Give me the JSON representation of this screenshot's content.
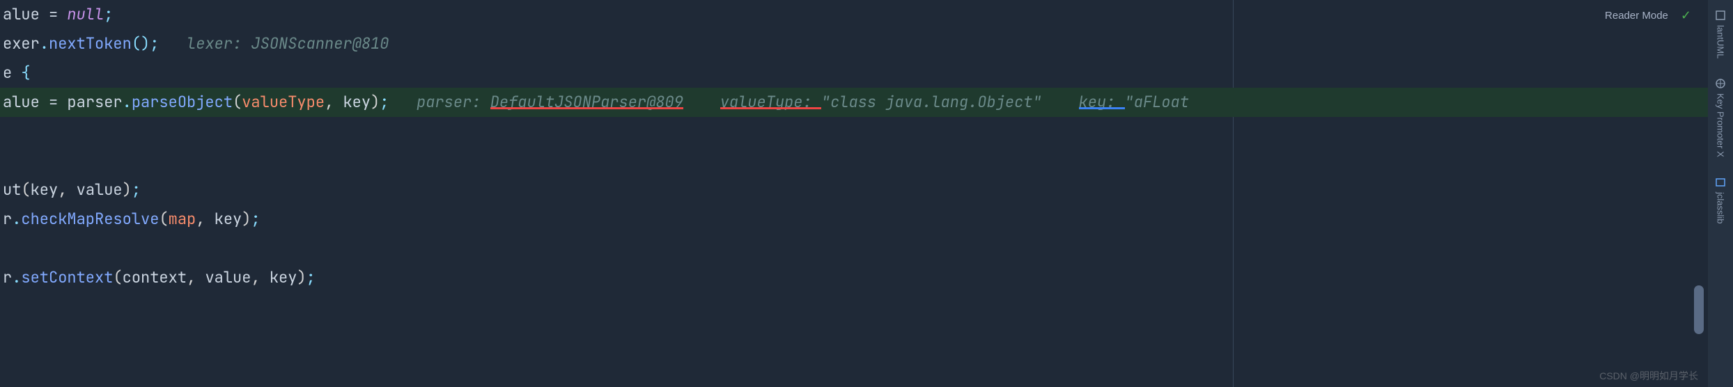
{
  "topbar": {
    "reader_mode": "Reader Mode"
  },
  "toolbar": {
    "plantuml": "lantUML",
    "keypromoter": "Key Promoter X",
    "jclasslib": "jclasslib"
  },
  "code": {
    "line1": {
      "alue": "alue",
      "eq": " = ",
      "null": "null",
      "semi": ";"
    },
    "line2": {
      "exer": "exer",
      "dot": ".",
      "nextToken": "nextToken",
      "paren": "()",
      "semi": ";",
      "sp": "   ",
      "hint_label": "lexer: ",
      "hint_val": "JSONScanner@810"
    },
    "line3": {
      "e": "e",
      "brace": " {"
    },
    "line4": {
      "alue": "alue",
      "eq": " = ",
      "parser": "parser",
      "dot": ".",
      "parseObject": "parseObject",
      "open": "(",
      "valueType": "valueType",
      "comma": ", ",
      "key": "key",
      "close": ")",
      "semi": ";",
      "sp1": "   ",
      "h1_label": "parser: ",
      "h1_val": "DefaultJSONParser@809",
      "sp2": "    ",
      "h2_label": "valueType: ",
      "h2_val": "\"class java.lang.Object\"",
      "sp3": "    ",
      "h3_label": "key: ",
      "h3_val": "\"aFLoat"
    },
    "line7": {
      "ut": "ut",
      "open": "(",
      "key": "key",
      "comma": ", ",
      "value": "value",
      "close": ")",
      "semi": ";"
    },
    "line8": {
      "r": "r",
      "dot": ".",
      "checkMapResolve": "checkMapResolve",
      "open": "(",
      "map": "map",
      "comma": ", ",
      "key": "key",
      "close": ")",
      "semi": ";"
    },
    "line10": {
      "r": "r",
      "dot": ".",
      "setContext": "setContext",
      "open": "(",
      "context": "context",
      "comma1": ", ",
      "value": "value",
      "comma2": ", ",
      "key": "key",
      "close": ")",
      "semi": ";"
    }
  },
  "watermark": "CSDN @明明如月学长"
}
